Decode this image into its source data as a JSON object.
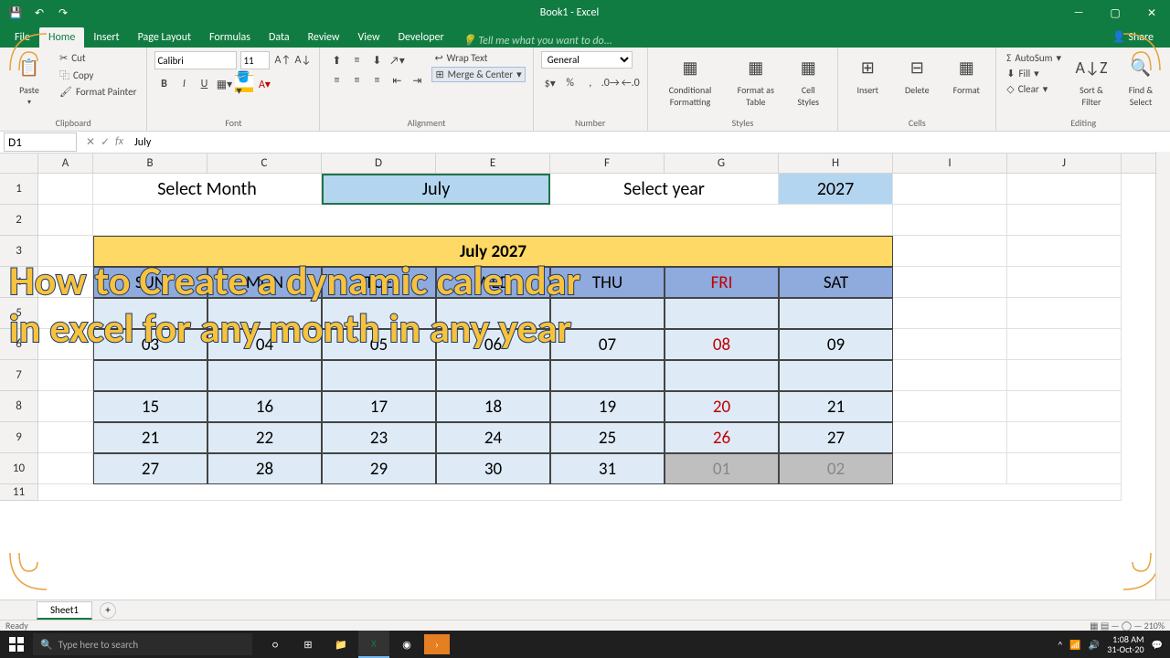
{
  "app": {
    "title": "Book1 - Excel"
  },
  "qat": {
    "save": "💾",
    "undo": "↶",
    "redo": "↷"
  },
  "window": {
    "min": "—",
    "max": "▢",
    "close": "✕"
  },
  "tabs": [
    "File",
    "Home",
    "Insert",
    "Page Layout",
    "Formulas",
    "Data",
    "Review",
    "View",
    "Developer"
  ],
  "tellme": "Tell me what you want to do...",
  "share": "Share",
  "ribbon": {
    "clipboard": {
      "paste": "Paste",
      "cut": "Cut",
      "copy": "Copy",
      "painter": "Format Painter",
      "label": "Clipboard"
    },
    "font": {
      "name": "Calibri",
      "size": "11",
      "label": "Font"
    },
    "alignment": {
      "wrap": "Wrap Text",
      "merge": "Merge & Center",
      "label": "Alignment"
    },
    "number": {
      "format": "General",
      "label": "Number"
    },
    "styles": {
      "cond": "Conditional Formatting",
      "table": "Format as Table",
      "cellstyles": "Cell Styles",
      "label": "Styles"
    },
    "cells": {
      "insert": "Insert",
      "delete": "Delete",
      "format": "Format",
      "label": "Cells"
    },
    "editing": {
      "autosum": "AutoSum",
      "fill": "Fill",
      "clear": "Clear",
      "sort": "Sort & Filter",
      "find": "Find & Select",
      "label": "Editing"
    }
  },
  "fbar": {
    "cellref": "D1",
    "formula": "July"
  },
  "cols": [
    "A",
    "B",
    "C",
    "D",
    "E",
    "F",
    "G",
    "H",
    "I",
    "J"
  ],
  "rowheads": [
    "1",
    "2",
    "3",
    "4",
    "5",
    "6",
    "7",
    "8",
    "9",
    "10",
    "11"
  ],
  "sheet": {
    "selectMonthLabel": "Select Month",
    "month": "July",
    "selectYearLabel": "Select year",
    "year": "2027",
    "calTitle": "July 2027",
    "days": [
      "SUN",
      "MON",
      "TUE",
      "WED",
      "THU",
      "FRI",
      "SAT"
    ],
    "grid": [
      [
        "",
        "",
        "",
        "",
        "",
        "",
        ""
      ],
      [
        "03",
        "04",
        "05",
        "06",
        "07",
        "08",
        "09"
      ],
      [
        "",
        "",
        "",
        "",
        "",
        "",
        ""
      ],
      [
        "15",
        "16",
        "17",
        "18",
        "19",
        "20",
        "21"
      ],
      [
        "21",
        "22",
        "23",
        "24",
        "25",
        "26",
        "27"
      ],
      [
        "27",
        "28",
        "29",
        "30",
        "31",
        "01",
        "02"
      ]
    ]
  },
  "overlay": {
    "l1": "How to Create a dynamic calendar",
    "l2": "in excel for any month in any year"
  },
  "sheetTab": "Sheet1",
  "status": {
    "ready": "Ready",
    "zoom": "210%"
  },
  "taskbar": {
    "searchPlaceholder": "Type here to search",
    "time": "1:08 AM",
    "date": "31-Oct-20"
  }
}
